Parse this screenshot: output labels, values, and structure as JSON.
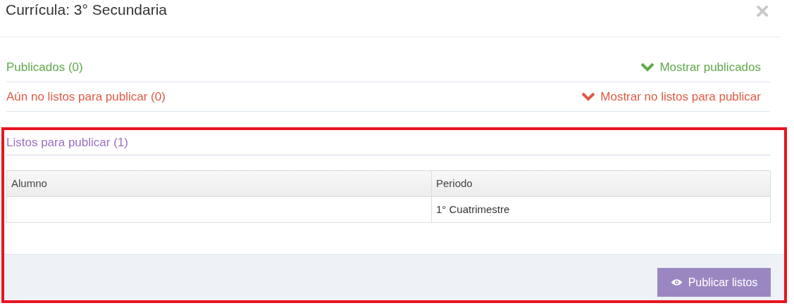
{
  "modal": {
    "title": "Currícula: 3° Secundaria",
    "close": "×"
  },
  "sections": [
    {
      "label": "Publicados (0)",
      "toggle": "Mostrar publicados",
      "expanded": false,
      "color": "#5fa84a"
    },
    {
      "label": "Aún no listos para publicar (0)",
      "toggle": "Mostrar no listos para publicar",
      "expanded": false,
      "color": "#e05a45"
    }
  ],
  "ready": {
    "label": "Listos para publicar (1)",
    "color": "#9b6fc4",
    "table": {
      "columns": [
        "Alumno",
        "Periodo"
      ],
      "rows": [
        [
          "",
          "1° Cuatrimestre"
        ]
      ]
    },
    "button": "Publicar listos"
  }
}
